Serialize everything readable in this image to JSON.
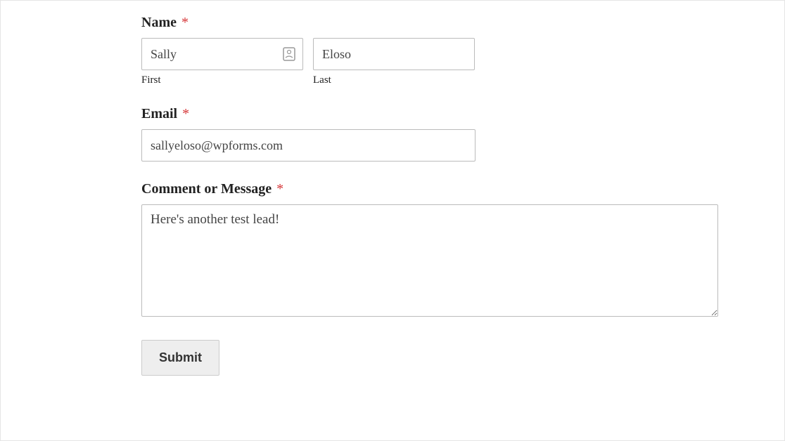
{
  "form": {
    "name": {
      "label": "Name",
      "required_marker": "*",
      "first_value": "Sally",
      "first_sublabel": "First",
      "last_value": "Eloso",
      "last_sublabel": "Last"
    },
    "email": {
      "label": "Email",
      "required_marker": "*",
      "value": "sallyeloso@wpforms.com"
    },
    "message": {
      "label": "Comment or Message",
      "required_marker": "*",
      "value": "Here's another test lead!"
    },
    "submit_label": "Submit"
  }
}
